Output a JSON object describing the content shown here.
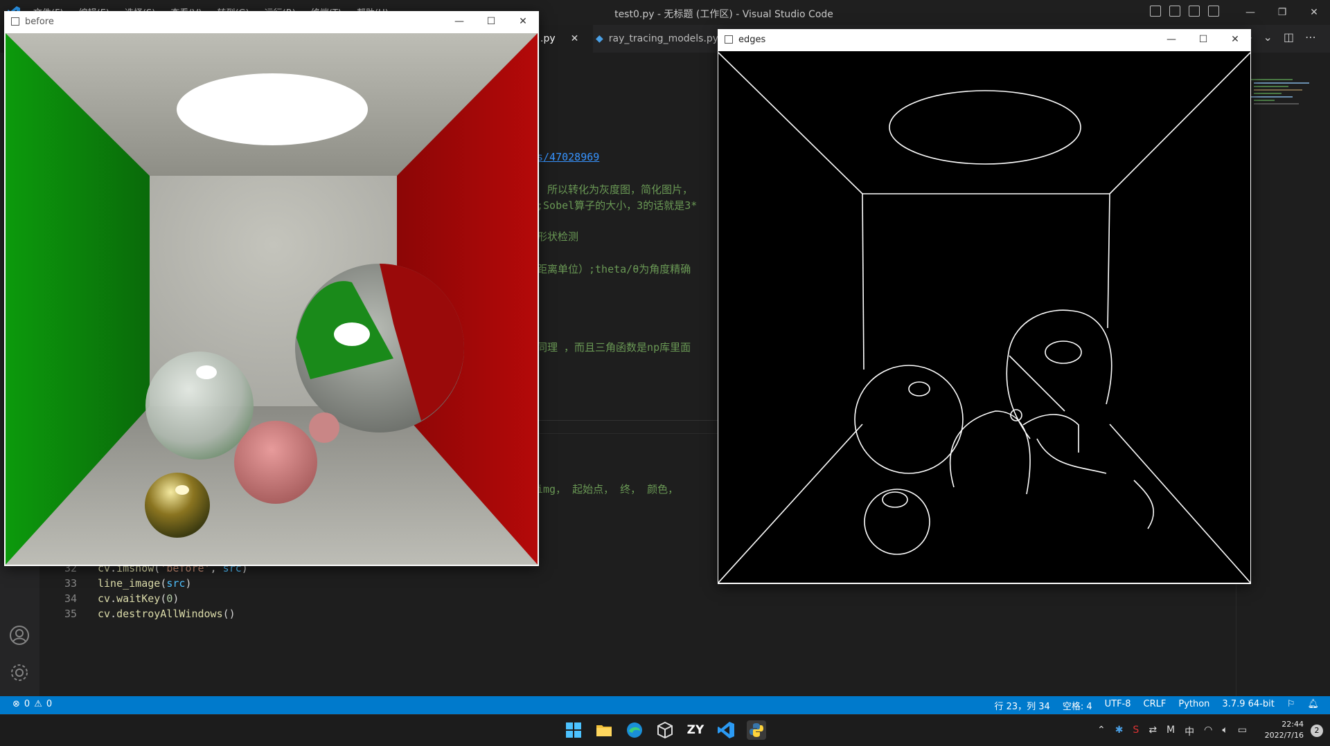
{
  "vscode": {
    "menu": [
      "文件(F)",
      "编辑(E)",
      "选择(S)",
      "查看(V)",
      "转到(G)",
      "运行(R)",
      "终端(T)",
      "帮助(H)"
    ],
    "window_title": "test0.py - 无标题 (工作区) - Visual Studio Code",
    "tabs": [
      {
        "label": ".py",
        "active": true
      },
      {
        "label": "ray_tracing_models.py",
        "active": false
      }
    ],
    "visible_fragments": [
      "s/47028969",
      "所以转化为灰度图，简化图片，",
      ";Sobel算子的大小，3的话就是3*",
      "形状检测",
      "距离单位）;theta/θ为角度精确",
      "同理 ，而且三角函数是np库里面",
      "img， 起始点， 终， 颜色，"
    ],
    "code_lines": [
      {
        "num": "32",
        "parts": [
          [
            "fn",
            "cv"
          ],
          [
            "def",
            "."
          ],
          [
            "fn",
            "imshow"
          ],
          [
            "def",
            "("
          ],
          [
            "str",
            "'before'"
          ],
          [
            "def",
            ", "
          ],
          [
            "var",
            "src"
          ],
          [
            "def",
            ")"
          ]
        ]
      },
      {
        "num": "33",
        "parts": [
          [
            "fn",
            "line_image"
          ],
          [
            "def",
            "("
          ],
          [
            "var",
            "src"
          ],
          [
            "def",
            ")"
          ]
        ]
      },
      {
        "num": "34",
        "parts": [
          [
            "fn",
            "cv"
          ],
          [
            "def",
            "."
          ],
          [
            "fn",
            "waitKey"
          ],
          [
            "def",
            "("
          ],
          [
            "num",
            "0"
          ],
          [
            "def",
            ")"
          ]
        ]
      },
      {
        "num": "35",
        "parts": [
          [
            "fn",
            "cv"
          ],
          [
            "def",
            "."
          ],
          [
            "fn",
            "destroyAllWindows"
          ],
          [
            "def",
            "()"
          ]
        ]
      }
    ],
    "status": {
      "errors": "0",
      "warnings": "0",
      "position": "行 23，列 34",
      "spaces": "空格: 4",
      "encoding": "UTF-8",
      "eol": "CRLF",
      "language": "Python",
      "interpreter": "3.7.9 64-bit"
    },
    "accent": "#007acc"
  },
  "before_window": {
    "title": "before"
  },
  "edges_window": {
    "title": "edges"
  },
  "taskbar": {
    "apps": [
      "start",
      "file-explorer",
      "edge",
      "box-app",
      "ZY",
      "vscode",
      "python"
    ],
    "zy_label": "ZY",
    "ime": "中",
    "time": "22:44",
    "date": "2022/7/16",
    "notifications": "2"
  }
}
